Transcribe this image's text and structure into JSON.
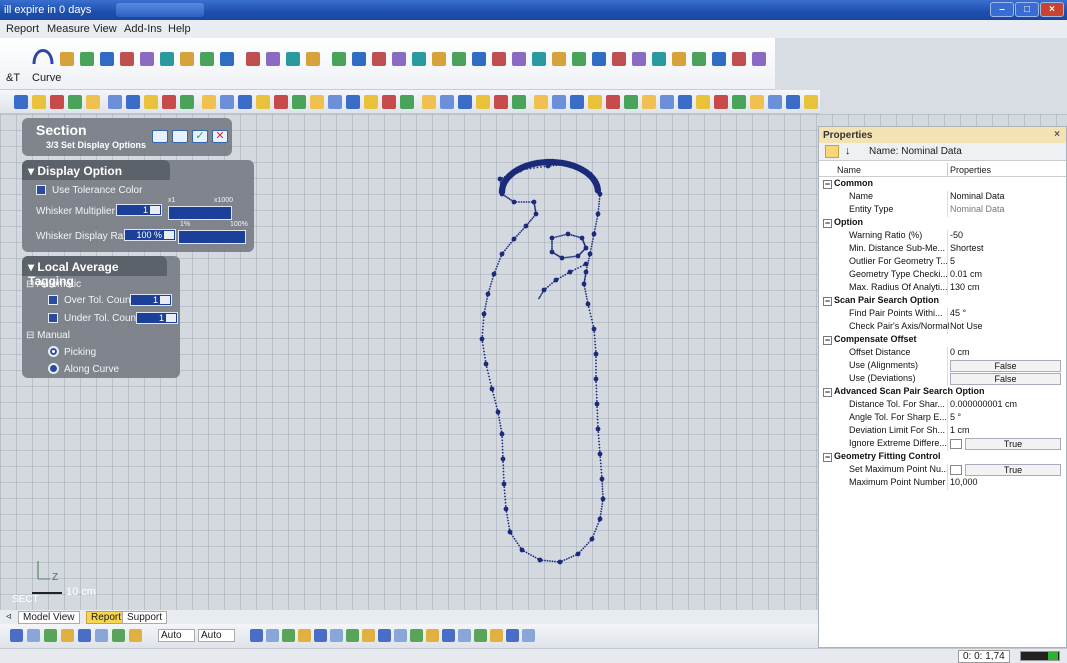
{
  "window": {
    "title": "ill expire in 0 days"
  },
  "menu": [
    "Report",
    "Measure",
    "View",
    "Add-Ins",
    "Help"
  ],
  "ribbon": {
    "label_left": "&T",
    "label_curve": "Curve"
  },
  "section_panel": {
    "title": "Section",
    "subtitle": "3/3 Set Display Options"
  },
  "display_option": {
    "title": "Display Option",
    "use_tolerance_color": "Use Tolerance Color",
    "whisker_multiplier_label": "Whisker Multiplier",
    "whisker_multiplier_value": "1",
    "whisker_multiplier_min": "x1",
    "whisker_multiplier_max": "x1000",
    "whisker_display_ratio_label": "Whisker Display Ratio",
    "whisker_display_ratio_value": "100 %",
    "whisker_display_ratio_min": "1%",
    "whisker_display_ratio_max": "100%"
  },
  "local_average": {
    "title": "Local Average Tagging",
    "automatic": "Automatic",
    "over_tol_count": "Over Tol. Count",
    "over_tol_value": "1",
    "under_tol_count": "Under Tol. Count",
    "under_tol_value": "1",
    "manual": "Manual",
    "picking": "Picking",
    "along_curve": "Along Curve"
  },
  "viewport": {
    "axis_label": "Z",
    "scale_text": "10 cm",
    "view_label": "SECT"
  },
  "tabs": [
    "Model View",
    "Report",
    "Support"
  ],
  "bottom_toolbar": {
    "auto1": "Auto",
    "auto2": "Auto"
  },
  "properties": {
    "title": "Properties",
    "close": "×",
    "name_header": "Name: Nominal Data",
    "col_name": "Name",
    "col_props": "Properties",
    "rows": [
      {
        "cat": true,
        "name": "Common"
      },
      {
        "name": "Name",
        "value": "Nominal Data"
      },
      {
        "name": "Entity Type",
        "value": "Nominal Data",
        "grey": true
      },
      {
        "cat": true,
        "name": "Option"
      },
      {
        "name": "Warning Ratio (%)",
        "value": "-50"
      },
      {
        "name": "Min. Distance Sub-Me...",
        "value": "Shortest"
      },
      {
        "name": "Outlier For Geometry T...",
        "value": "5"
      },
      {
        "name": "Geometry Type Checki...",
        "value": "0.01 cm"
      },
      {
        "name": "Max. Radius Of Analyti...",
        "value": "130 cm"
      },
      {
        "cat": true,
        "name": "Scan Pair Search Option"
      },
      {
        "name": "Find Pair Points Withi...",
        "value": "45 °"
      },
      {
        "name": "Check Pair's Axis/Normal",
        "value": "Not Use"
      },
      {
        "cat": true,
        "name": "Compensate Offset"
      },
      {
        "name": "Offset Distance",
        "value": "0 cm"
      },
      {
        "name": "Use (Alignments)",
        "value": "False",
        "btn": true
      },
      {
        "name": "Use (Deviations)",
        "value": "False",
        "btn": true
      },
      {
        "cat": true,
        "name": "Advanced Scan Pair Search Option"
      },
      {
        "name": "Distance Tol. For Shar...",
        "value": "0.000000001 cm"
      },
      {
        "name": "Angle Tol. For Sharp E...",
        "value": "5 °"
      },
      {
        "name": "Deviation Limit For Sh...",
        "value": "1 cm"
      },
      {
        "name": "Ignore Extreme Differe...",
        "value": "True",
        "btn": true,
        "box": true
      },
      {
        "cat": true,
        "name": "Geometry Fitting Control"
      },
      {
        "name": "Set Maximum Point Nu...",
        "value": "True",
        "btn": true,
        "box": true
      },
      {
        "name": "Maximum Point Number",
        "value": "10,000"
      }
    ]
  },
  "status": {
    "coords": "0: 0: 1,74"
  },
  "colors": {
    "curve": "#1b2a7a",
    "panel": "#7a7f86",
    "accent": "#f3e3b4"
  }
}
